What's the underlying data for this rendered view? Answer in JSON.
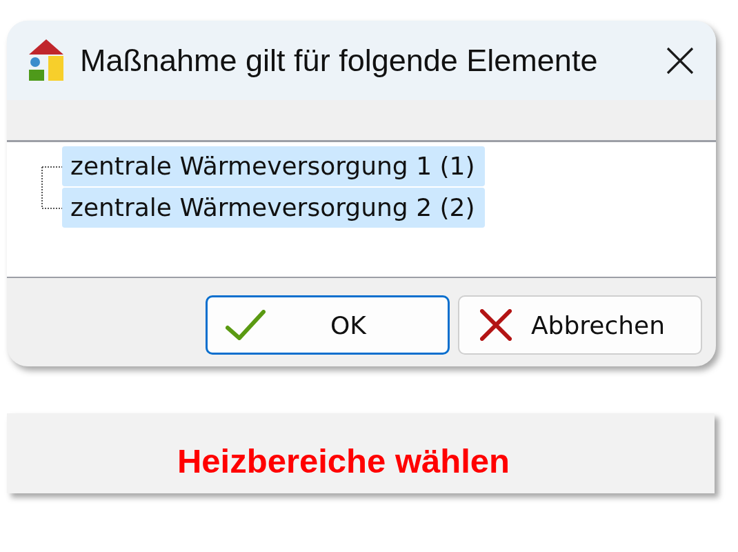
{
  "dialog": {
    "title": "Maßnahme gilt für folgende Elemente",
    "tree": {
      "items": [
        {
          "label": "zentrale Wärmeversorgung 1 (1)",
          "selected": true
        },
        {
          "label": "zentrale Wärmeversorgung 2 (2)",
          "selected": true
        }
      ]
    },
    "buttons": [
      {
        "label": "OK",
        "kind": "confirm",
        "default": true
      },
      {
        "label": "Abbrechen",
        "kind": "cancel",
        "default": false
      }
    ]
  },
  "banner": {
    "text": "Heizbereiche wählen"
  }
}
